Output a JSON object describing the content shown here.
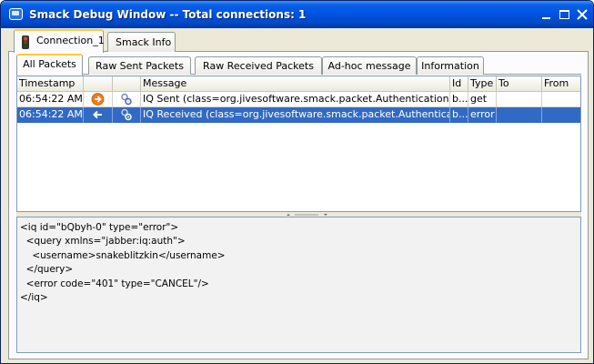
{
  "window": {
    "title": "Smack Debug Window -- Total connections: 1",
    "controls": [
      "minimize",
      "maximize",
      "close"
    ]
  },
  "main_tabs": [
    {
      "label": "Connection_1",
      "icon": "traffic-light-icon",
      "active": true
    },
    {
      "label": "Smack Info",
      "active": false
    }
  ],
  "sub_tabs": [
    {
      "label": "All Packets",
      "active": true
    },
    {
      "label": "Raw Sent Packets",
      "active": false
    },
    {
      "label": "Raw Received Packets",
      "active": false
    },
    {
      "label": "Ad-hoc message",
      "active": false
    },
    {
      "label": "Information",
      "active": false
    }
  ],
  "table": {
    "columns": [
      "Timestamp",
      "",
      "",
      "Message",
      "Id",
      "Type",
      "To",
      "From"
    ],
    "rows": [
      {
        "timestamp": "06:54:22 AM",
        "direction_icon": "sent-arrow-icon",
        "packet_icon": "iq-packet-icon",
        "message": "IQ Sent (class=org.jivesoftware.smack.packet.Authentication)",
        "id": "b...",
        "type": "get",
        "to": "",
        "from": "",
        "selected": false
      },
      {
        "timestamp": "06:54:22 AM",
        "direction_icon": "received-arrow-icon",
        "packet_icon": "iq-packet-icon",
        "message": "IQ Received (class=org.jivesoftware.smack.packet.Authentication)",
        "id": "b...",
        "type": "error",
        "to": "",
        "from": "",
        "selected": true
      }
    ]
  },
  "xml_detail": {
    "lines": [
      "<iq id=\"bQbyh-0\" type=\"error\">",
      "  <query xmlns=\"jabber:iq:auth\">",
      "    <username>snakeblitzkin</username>",
      "  </query>",
      "  <error code=\"401\" type=\"CANCEL\"/>",
      "</iq>"
    ]
  },
  "colors": {
    "titlebar": "#0054e3",
    "selection": "#316ac5",
    "active_tab_highlight": "#ffc83c",
    "sent_arrow": "#f07a1a",
    "window_bg": "#ece9d8"
  }
}
